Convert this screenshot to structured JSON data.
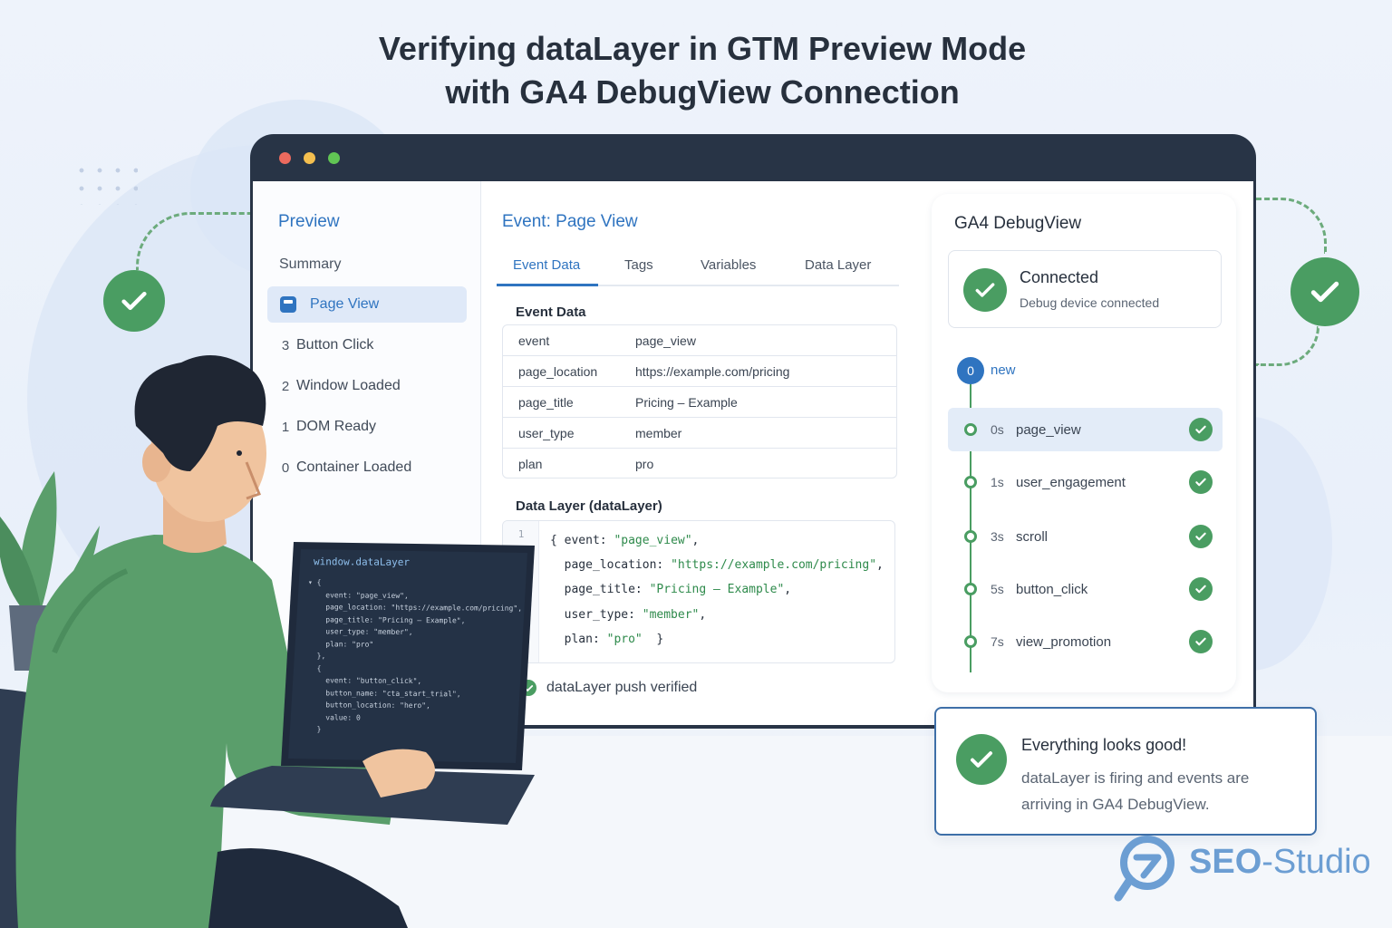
{
  "title": {
    "line1": "Verifying dataLayer in GTM Preview Mode",
    "line2": "with GA4 DebugView Connection"
  },
  "colors": {
    "accent_blue": "#2f74c0",
    "success_green": "#4a9d62",
    "window_dark": "#283446",
    "background": "#eef3fb"
  },
  "gtm": {
    "sidebar": {
      "title": "Preview",
      "summary": "Summary",
      "items": [
        {
          "num": "",
          "label": "Page View",
          "active": true,
          "icon": "page-icon"
        },
        {
          "num": "3",
          "label": "Button Click"
        },
        {
          "num": "2",
          "label": "Window Loaded"
        },
        {
          "num": "1",
          "label": "DOM Ready"
        },
        {
          "num": "0",
          "label": "Container Loaded"
        }
      ]
    },
    "main": {
      "title": "Event: Page View",
      "tabs": [
        "Event Data",
        "Tags",
        "Variables",
        "Data Layer"
      ],
      "active_tab": "Event Data",
      "event_data_title": "Event Data",
      "event_data": [
        {
          "key": "event",
          "value": "page_view"
        },
        {
          "key": "page_location",
          "value": "https://example.com/pricing"
        },
        {
          "key": "page_title",
          "value": "Pricing – Example"
        },
        {
          "key": "user_type",
          "value": "member"
        },
        {
          "key": "plan",
          "value": "pro"
        }
      ],
      "data_layer_title": "Data Layer (dataLayer)",
      "code_line_number": "1",
      "code": {
        "l1_open": "{ event: ",
        "l1_val": "\"page_view\"",
        "l1_end": ",",
        "l2_key": "  page_location: ",
        "l2_val": "\"https://example.com/pricing\"",
        "l2_end": ",",
        "l3_key": "  page_title: ",
        "l3_val": "\"Pricing – Example\"",
        "l3_end": ",",
        "l4_key": "  user_type: ",
        "l4_val": "\"member\"",
        "l4_end": ",",
        "l5_key": "  plan: ",
        "l5_val": "\"pro\"",
        "l5_end": "  }"
      },
      "verified": "dataLayer push verified"
    }
  },
  "ga4": {
    "title": "GA4 DebugView",
    "connected_title": "Connected",
    "connected_sub": "Debug device connected",
    "new_count": "0",
    "new_label": "new",
    "events": [
      {
        "time": "0s",
        "name": "page_view",
        "active": true
      },
      {
        "time": "1s",
        "name": "user_engagement"
      },
      {
        "time": "3s",
        "name": "scroll"
      },
      {
        "time": "5s",
        "name": "button_click"
      },
      {
        "time": "7s",
        "name": "view_promotion"
      }
    ]
  },
  "success": {
    "title": "Everything looks good!",
    "text": "dataLayer is firing and events are arriving in GA4 DebugView."
  },
  "laptop": {
    "header": "window.dataLayer",
    "lines": [
      "▾ {",
      "    event: \"page_view\",",
      "    page_location: \"https://example.com/pricing\",",
      "    page_title: \"Pricing – Example\",",
      "    user_type: \"member\",",
      "    plan: \"pro\"",
      "  },",
      "  {",
      "    event: \"button_click\",",
      "    button_name: \"cta_start_trial\",",
      "    button_location: \"hero\",",
      "    value: 0",
      "  }"
    ]
  },
  "brand": {
    "name_bold": "SEO",
    "name_rest": "-Studio",
    "icon": "magnifier-logo-icon"
  }
}
